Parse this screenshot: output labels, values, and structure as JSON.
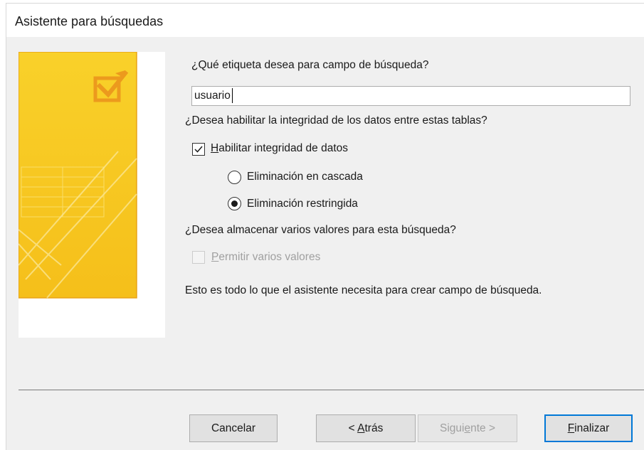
{
  "window": {
    "title": "Asistente para búsquedas"
  },
  "form": {
    "label_question": "¿Qué etiqueta desea para campo de búsqueda?",
    "label_input_value": "usuario",
    "integrity_question": "¿Desea habilitar la integridad de los datos entre estas tablas?",
    "integrity_checkbox": {
      "label_accel": "H",
      "label_rest": "abilitar integridad de datos",
      "checked": true
    },
    "cascade_delete": {
      "label": "Eliminación en cascada",
      "selected": false
    },
    "restrict_delete": {
      "label": "Eliminación restringida",
      "selected": true
    },
    "multi_question": "¿Desea almacenar varios valores para esta búsqueda?",
    "multi_checkbox": {
      "label_accel": "P",
      "label_rest": "ermitir varios valores",
      "checked": false,
      "enabled": false
    },
    "summary": "Esto es todo lo que el asistente necesita para crear campo de búsqueda."
  },
  "buttons": {
    "cancel": {
      "label": "Cancelar"
    },
    "back": {
      "prefix": "< ",
      "accel": "A",
      "rest": "trás"
    },
    "next": {
      "pre": "Sigui",
      "accel": "e",
      "rest": "nte >",
      "enabled": false
    },
    "finish": {
      "accel": "F",
      "rest": "inalizar"
    }
  },
  "icons": {
    "wizard_art": "lookup-wizard-illustration",
    "check": "checkmark-icon"
  },
  "colors": {
    "art_yellow": "#f7c21e",
    "art_border": "#e8a317",
    "accent": "#0078d7"
  }
}
